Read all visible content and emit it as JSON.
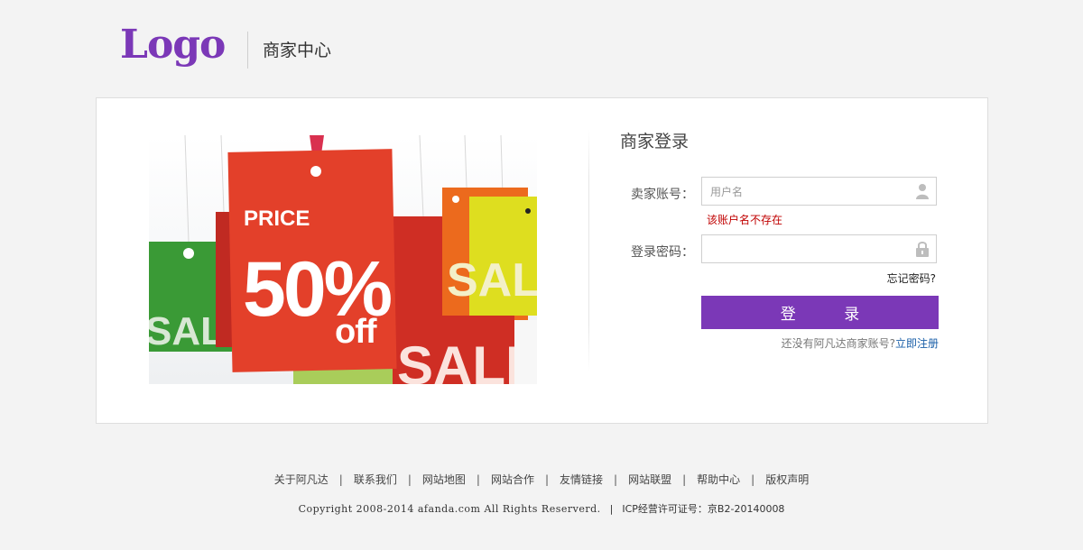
{
  "header": {
    "logo_text": "Logo",
    "title": "商家中心"
  },
  "banner": {
    "tag_price": "PRICE",
    "tag_percent": "50%",
    "tag_off": "off",
    "sale_text": "SALE"
  },
  "login": {
    "title": "商家登录",
    "username_label": "卖家账号：",
    "username_placeholder": "用户名",
    "username_value": "",
    "username_error": "该账户名不存在",
    "password_label": "登录密码：",
    "password_value": "",
    "forgot_label": "忘记密码?",
    "submit_label": "登 录",
    "register_prompt": "还没有阿凡达商家账号?",
    "register_link": "立即注册"
  },
  "footer": {
    "links": [
      "关于阿凡达",
      "联系我们",
      "网站地图",
      "网站合作",
      "友情链接",
      "网站联盟",
      "帮助中心",
      "版权声明"
    ],
    "copyright": "Copyright  2008-2014 afanda.com All Rights Reserverd.",
    "icp": "ICP经营许可证号：京B2-20140008"
  },
  "colors": {
    "brand_purple": "#7b38b7",
    "error_red": "#c00000",
    "link_blue": "#1a5fa8"
  },
  "icons": {
    "username": "user-icon",
    "password": "lock-icon"
  }
}
